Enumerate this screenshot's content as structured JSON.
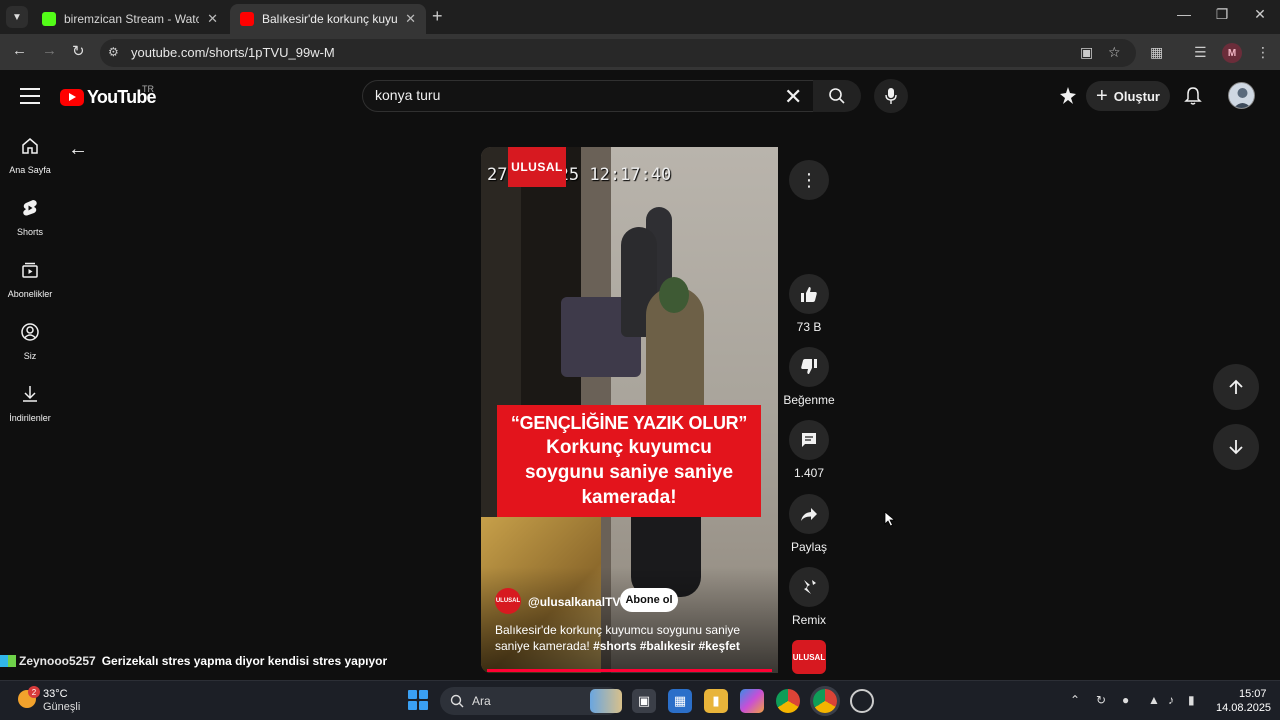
{
  "browser": {
    "tabs": [
      {
        "title": "biremzican Stream - Watch Live",
        "favicon_color": "#53fc18"
      },
      {
        "title": "Balıkesir'de korkunç kuyumcu soygunu",
        "favicon_color": "#ff0000"
      }
    ],
    "url": "youtube.com/shorts/1pTVU_99w-M",
    "profile_initial": "M"
  },
  "youtube": {
    "logo_text": "YouTube",
    "country_code": "TR",
    "search": {
      "value": "konya turu"
    },
    "create_label": "Oluştur",
    "nav": [
      {
        "label": "Ana Sayfa",
        "icon": "home-icon"
      },
      {
        "label": "Shorts",
        "icon": "shorts-icon"
      },
      {
        "label": "Abonelikler",
        "icon": "subscriptions-icon"
      },
      {
        "label": "Siz",
        "icon": "you-icon"
      },
      {
        "label": "İndirilenler",
        "icon": "download-icon"
      }
    ]
  },
  "short": {
    "timestamp": "27.0 2025 12:17:40",
    "overlay_logo": "ULUSAL",
    "headline_line1": "“GENÇLİĞİNE YAZIK OLUR”",
    "headline_line2": "Korkunç kuyumcu",
    "headline_line3": "soygunu saniye saniye",
    "headline_line4": "kamerada!",
    "channel_handle": "@ulusalkanalTV",
    "channel_logo": "ULUSAL",
    "subscribe_label": "Abone ol",
    "description": "Balıkesir'de korkunç kuyumcu soygunu saniye saniye kamerada!",
    "hashtags": "#shorts #balıkesir #keşfet",
    "actions": {
      "like_count": "73 B",
      "dislike_label": "Beğenme",
      "comment_count": "1.407",
      "share_label": "Paylaş",
      "remix_label": "Remix"
    },
    "accent_color": "#d71920"
  },
  "chat_overlay": {
    "user": "Zeynooo5257",
    "message": "Gerizekalı stres yapma diyor kendisi stres yapıyor"
  },
  "taskbar": {
    "temperature": "33°C",
    "weather_condition": "Güneşli",
    "weather_badge": "2",
    "search_label": "Ara",
    "time": "15:07",
    "date": "14.08.2025"
  }
}
